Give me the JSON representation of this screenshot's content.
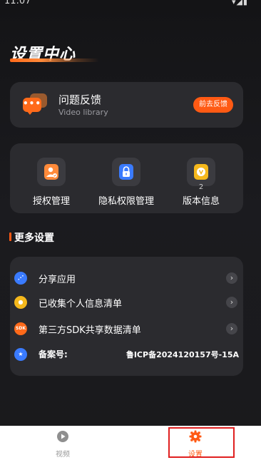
{
  "status_bar": {
    "time": "11:07",
    "icons": "▾◢▮"
  },
  "header": {
    "title": "设置中心"
  },
  "feedback": {
    "title": "问题反馈",
    "subtitle": "Video library",
    "button_label": "前去反馈",
    "icon": "chat-bubble-icon",
    "icon_text": "•••"
  },
  "permissions": {
    "items": [
      {
        "label": "授权管理",
        "icon": "user-auth-icon",
        "color": "#ff8a3a"
      },
      {
        "label": "隐私权限管理",
        "icon": "lock-icon",
        "color": "#3a7bff"
      },
      {
        "label": "版本信息",
        "icon": "version-icon",
        "color": "#f5b81c",
        "badge": "2"
      }
    ]
  },
  "more_settings": {
    "title": "更多设置",
    "items": [
      {
        "label": "分享应用",
        "icon": "share-icon",
        "color": "#3a7bff",
        "icon_text": "⋰"
      },
      {
        "label": "已收集个人信息清单",
        "icon": "user-info-icon",
        "color": "#f5b81c",
        "icon_text": "●"
      },
      {
        "label": "第三方SDK共享数据清单",
        "icon": "sdk-icon",
        "color": "#ff6a1a",
        "icon_text": "SDK"
      },
      {
        "label": "备案号:",
        "icon": "record-icon",
        "color": "#3a7bff",
        "icon_text": "★",
        "value": "鲁ICP备2024120157号-15A"
      }
    ]
  },
  "tabbar": {
    "tabs": [
      {
        "label": "视频",
        "icon": "play-icon",
        "active": false,
        "color": "#9a9a9a"
      },
      {
        "label": "设置",
        "icon": "gear-icon",
        "active": true,
        "color": "#ff5a14"
      }
    ]
  },
  "colors": {
    "accent": "#ff5a14",
    "card": "#2b2b2f",
    "background": "#1a1a1c"
  }
}
